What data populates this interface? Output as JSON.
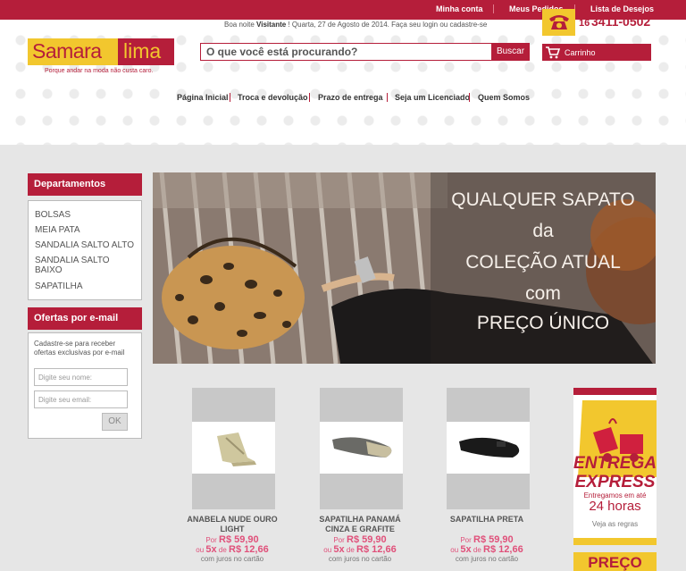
{
  "topbar": {
    "links": [
      "Minha conta",
      "Meus Pedidos",
      "Lista de Desejos"
    ]
  },
  "header": {
    "logo_part1": "Samara",
    "logo_part2": "lima",
    "tagline": "Porque andar na moda não custa caro.",
    "greeting_prefix": "Boa noite ",
    "greeting_user": "Visitante",
    "greeting_suffix": " ! Quarta, 27 de Agosto de 2014. Faça seu login ou cadastre-se",
    "search_placeholder": "O que você está procurando?",
    "search_button": "Buscar",
    "phone_area": "16",
    "phone_number": "3411-0502",
    "cart_label": "Carrinho"
  },
  "nav": [
    "Página Inicial",
    "Troca e devolução",
    "Prazo de entrega",
    "Seja um Licenciado",
    "Quem Somos"
  ],
  "sidebar": {
    "departments_title": "Departamentos",
    "departments": [
      "BOLSAS",
      "MEIA PATA",
      "SANDALIA SALTO ALTO",
      "SANDALIA SALTO BAIXO",
      "SAPATILHA"
    ],
    "offers_title": "Ofertas por e-mail",
    "offers_text": "Cadastre-se para receber ofertas exclusivas por e-mail",
    "name_placeholder": "Digite seu nome:",
    "email_placeholder": "Digite seu email:",
    "ok_button": "OK"
  },
  "banner": {
    "lines": [
      "QUALQUER SAPATO",
      "da",
      "COLEÇÃO ATUAL",
      "com",
      "PREÇO ÚNICO"
    ]
  },
  "products": [
    {
      "name": "ANABELA NUDE OURO LIGHT",
      "por_label": "Por",
      "price": "R$ 59,90",
      "installment_prefix": "ou",
      "installment_count": "5x",
      "installment_de": "de",
      "installment_value": "R$ 12,66",
      "juros": "com juros no cartão"
    },
    {
      "name": "SAPATILHA PANAMÁ CINZA E GRAFITE",
      "por_label": "Por",
      "price": "R$ 59,90",
      "installment_prefix": "ou",
      "installment_count": "5x",
      "installment_de": "de",
      "installment_value": "R$ 12,66",
      "juros": "com juros no cartão"
    },
    {
      "name": "SAPATILHA PRETA",
      "por_label": "Por",
      "price": "R$ 59,90",
      "installment_prefix": "ou",
      "installment_count": "5x",
      "installment_de": "de",
      "installment_value": "R$ 12,66",
      "juros": "com juros no cartão"
    }
  ],
  "express_ad": {
    "line1": "ENTREGA",
    "line2": "EXPRESS",
    "line3": "Entregamos em até",
    "line4": "24 horas",
    "line5": "Veja as regras"
  },
  "preco_ad": {
    "text": "PREÇO"
  },
  "colors": {
    "brand_red": "#b51e3a",
    "brand_yellow": "#f2c72e",
    "price_pink": "#e0507a"
  }
}
